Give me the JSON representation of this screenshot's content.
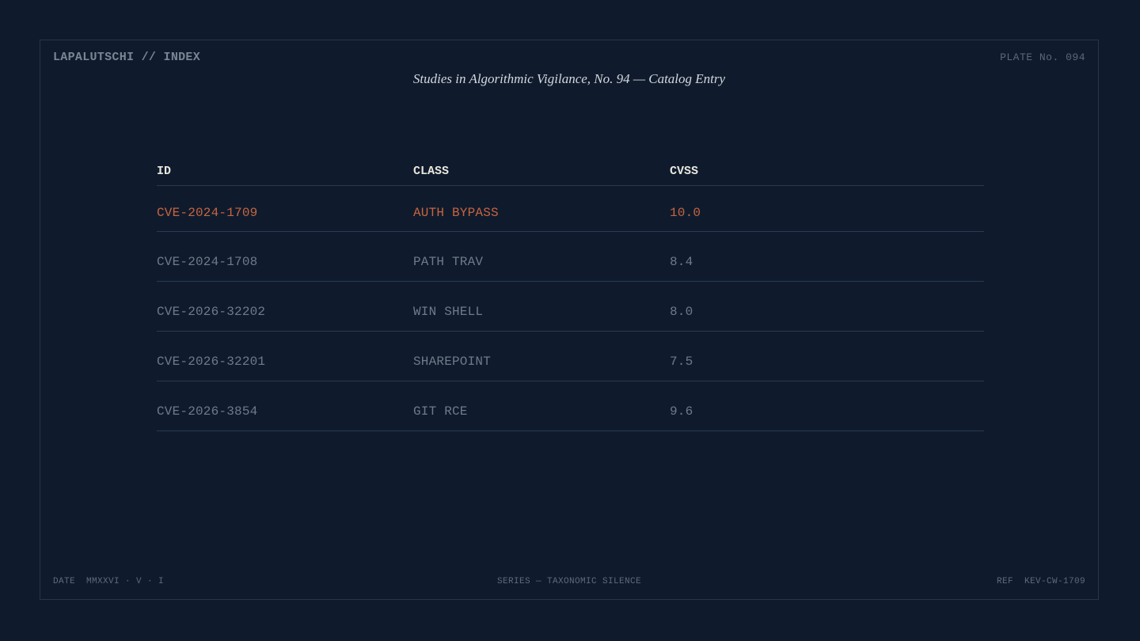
{
  "header": {
    "brand": "LAPALUTSCHI // INDEX",
    "plate": "PLATE No. 094",
    "title": "Studies in Algorithmic Vigilance, No. 94 — Catalog Entry"
  },
  "table": {
    "columns": [
      "ID",
      "CLASS",
      "CVSS"
    ],
    "rows": [
      {
        "id": "CVE-2024-1709",
        "class": "AUTH BYPASS",
        "cvss": "10.0",
        "highlight": true
      },
      {
        "id": "CVE-2024-1708",
        "class": "PATH TRAV",
        "cvss": "8.4",
        "highlight": false
      },
      {
        "id": "CVE-2026-32202",
        "class": "WIN SHELL",
        "cvss": "8.0",
        "highlight": false
      },
      {
        "id": "CVE-2026-32201",
        "class": "SHAREPOINT",
        "cvss": "7.5",
        "highlight": false
      },
      {
        "id": "CVE-2026-3854",
        "class": "GIT RCE",
        "cvss": "9.6",
        "highlight": false
      }
    ]
  },
  "footer": {
    "date": "DATE  MMXXVI · V · I",
    "series": "SERIES — TAXONOMIC SILENCE",
    "ref": "REF  KEV-CW-1709"
  },
  "colors": {
    "background": "#0f1b2d",
    "border": "#27344a",
    "highlight": "#c8643f",
    "header_text": "#e9e6dc"
  }
}
